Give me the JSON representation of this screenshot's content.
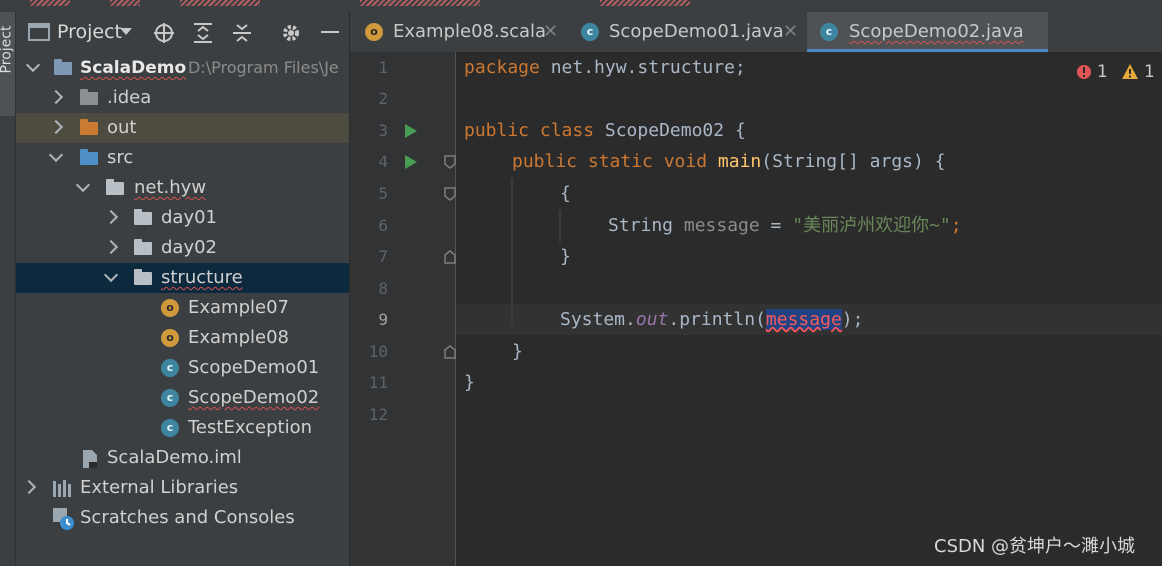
{
  "tool_window": {
    "stripe_label": "Project",
    "header_label": "Project"
  },
  "project_tree": [
    {
      "label": "ScalaDemo",
      "suffix": "D:\\Program Files\\Je",
      "kind": "module"
    },
    {
      "label": ".idea",
      "kind": "folder-gray"
    },
    {
      "label": "out",
      "kind": "folder-orange"
    },
    {
      "label": "src",
      "kind": "folder-blue"
    },
    {
      "label": "net.hyw",
      "kind": "package"
    },
    {
      "label": "day01",
      "kind": "package"
    },
    {
      "label": "day02",
      "kind": "package"
    },
    {
      "label": "structure",
      "kind": "package"
    },
    {
      "label": "Example07",
      "kind": "scala"
    },
    {
      "label": "Example08",
      "kind": "scala"
    },
    {
      "label": "ScopeDemo01",
      "kind": "java"
    },
    {
      "label": "ScopeDemo02",
      "kind": "java"
    },
    {
      "label": "TestException",
      "kind": "java"
    },
    {
      "label": "ScalaDemo.iml",
      "kind": "iml"
    },
    {
      "label": "External Libraries",
      "kind": "libs"
    },
    {
      "label": "Scratches and Consoles",
      "kind": "scratch"
    }
  ],
  "tabs": [
    {
      "label": "Example08.scala",
      "icon": "scala-object-icon"
    },
    {
      "label": "ScopeDemo01.java",
      "icon": "java-class-icon"
    },
    {
      "label": "ScopeDemo02.java",
      "icon": "java-class-icon",
      "active": true
    }
  ],
  "gutter": {
    "line_numbers": [
      "1",
      "2",
      "3",
      "4",
      "5",
      "6",
      "7",
      "8",
      "9",
      "10",
      "11",
      "12"
    ]
  },
  "code": {
    "l1_kw": "package",
    "l1_rest": " net.hyw.structure;",
    "l3_kw": "public class",
    "l3_rest": " ScopeDemo02 {",
    "l4_kw": "public static void",
    "l4_fn": "main",
    "l4_rest": "(String[] args) {",
    "l5": "{",
    "l6_type": "String ",
    "l6_var": "message",
    "l6_eq": " = ",
    "l6_str": "\"美丽泸州欢迎你~\"",
    "l6_end": ";",
    "l7": "}",
    "l9_a": "System.",
    "l9_out": "out",
    "l9_b": ".println(",
    "l9_err": "message",
    "l9_c": ");",
    "l10": "}",
    "l11": "}"
  },
  "inspections": {
    "errors": "1",
    "warnings": "1"
  },
  "watermark": "CSDN @贫坤户～濉小城",
  "colors": {
    "keyword": "#cc7832",
    "string": "#6a8759",
    "function": "#ffc66d",
    "error": "#f25c5c",
    "selection": "#214283",
    "accent": "#4a88c7"
  }
}
